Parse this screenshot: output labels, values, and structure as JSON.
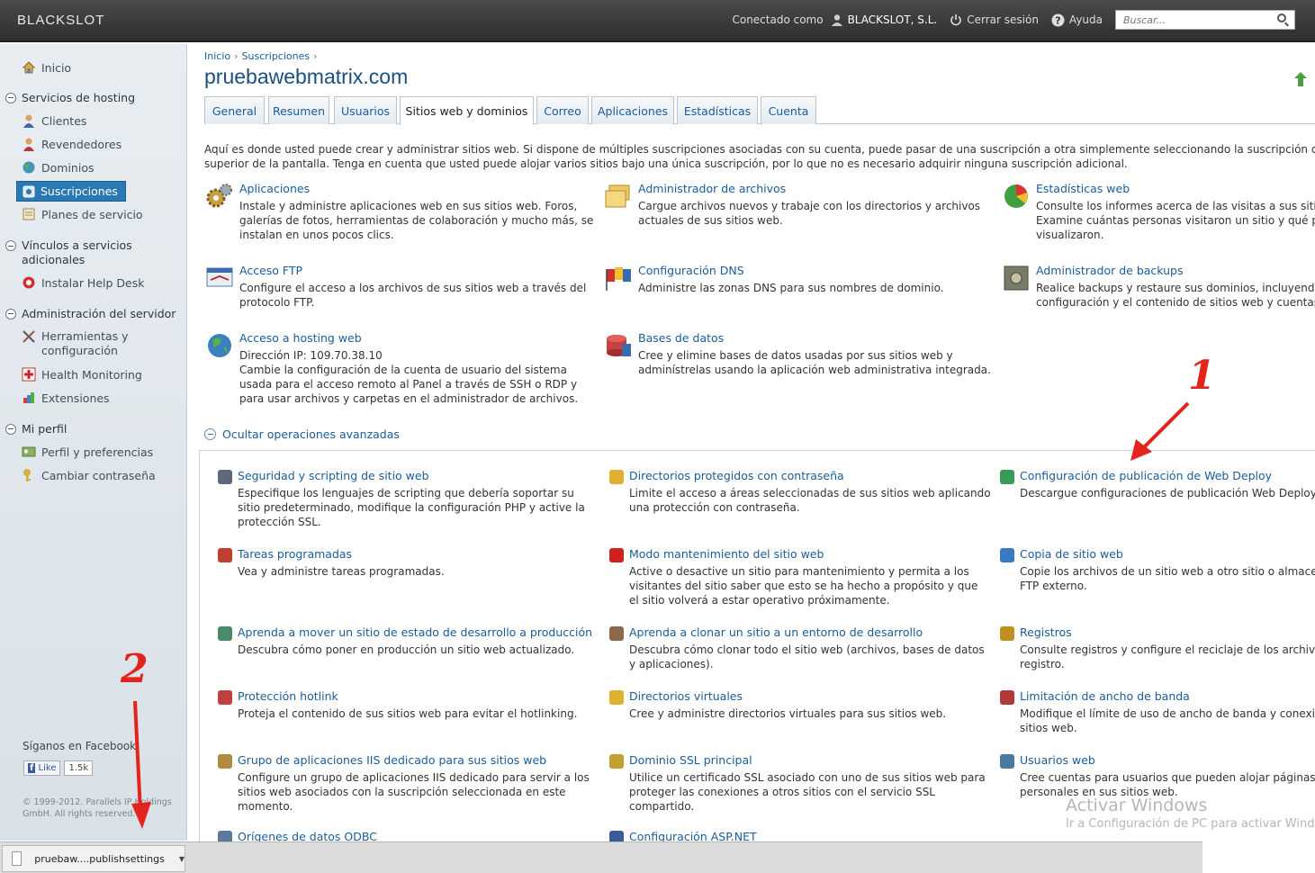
{
  "header": {
    "logo": "BLACKSLOT",
    "connected_as": "Conectado como",
    "user": "BLACKSLOT, S.L.",
    "logout": "Cerrar sesión",
    "help": "Ayuda",
    "search_placeholder": "Buscar..."
  },
  "sidebar": {
    "home": "Inicio",
    "sections": [
      {
        "title": "Servicios de hosting",
        "items": [
          "Clientes",
          "Revendedores",
          "Dominios",
          "Suscripciones",
          "Planes de servicio"
        ]
      },
      {
        "title": "Vínculos a servicios adicionales",
        "items": [
          "Instalar Help Desk"
        ]
      },
      {
        "title": "Administración del servidor",
        "items": [
          "Herramientas y configuración",
          "Health Monitoring",
          "Extensiones"
        ]
      },
      {
        "title": "Mi perfil",
        "items": [
          "Perfil y preferencias",
          "Cambiar contraseña"
        ]
      }
    ],
    "active_item": "Suscripciones",
    "facebook_label": "Síganos en Facebook",
    "facebook_like": "Like",
    "facebook_count": "1.5k",
    "copyright": "© 1999-2012. Parallels IP Holdings GmbH. All rights reserved."
  },
  "breadcrumb": [
    "Inicio",
    "Suscripciones"
  ],
  "page_title": "pruebawebmatrix.com",
  "tabs": [
    "General",
    "Resumen",
    "Usuarios",
    "Sitios web y dominios",
    "Correo",
    "Aplicaciones",
    "Estadísticas",
    "Cuenta"
  ],
  "active_tab": "Sitios web y dominios",
  "intro": [
    "Aquí es donde usted puede crear y administrar sitios web. Si dispone de múltiples suscripciones asociadas con su cuenta, puede pasar de una suscripción a otra simplemente seleccionando la suscripción deseada",
    "superior de la pantalla. Tenga en cuenta que usted puede alojar varios sitios bajo una única suscripción, por lo que no es necesario adquirir ninguna suscripción adicional."
  ],
  "tools": [
    {
      "title": "Aplicaciones",
      "desc": "Instale y administre aplicaciones web en sus sitios web. Foros,\ngalerías de fotos, herramientas de colaboración y mucho más, se\ninstalan en unos pocos clics.",
      "icon": "gears-icon"
    },
    {
      "title": "Administrador de archivos",
      "desc": "Cargue archivos nuevos y trabaje con los directorios y archivos\nactuales de sus sitios web.",
      "icon": "folders-icon"
    },
    {
      "title": "Estadísticas web",
      "desc": "Consulte los informes acerca de las visitas a sus sitio\nExamine cuántas personas visitaron un sitio y qué pá\nvisualizaron.",
      "icon": "pie-chart-icon"
    },
    {
      "title": "Acceso FTP",
      "desc": "Configure el acceso a los archivos de sus sitios web a través del\nprotocolo FTP.",
      "icon": "ftp-icon"
    },
    {
      "title": "Configuración DNS",
      "desc": "Administre las zonas DNS para sus nombres de dominio.",
      "icon": "dns-flags-icon"
    },
    {
      "title": "Administrador de backups",
      "desc": "Realice backups y restaure sus dominios, incluyendo\nconfiguración y el contenido de sitios web y cuentas",
      "icon": "safe-icon"
    },
    {
      "title": "Acceso a hosting web",
      "desc": "Dirección IP: 109.70.38.10\nCambie la configuración de la cuenta de usuario del sistema\nusada para el acceso remoto al Panel a través de SSH o RDP y\npara usar archivos y carpetas en el administrador de archivos.",
      "icon": "globe-icon"
    },
    {
      "title": "Bases de datos",
      "desc": "Cree y elimine bases de datos usadas por sus sitios web y\nadminístrelas usando la aplicación web administrativa integrada.",
      "icon": "database-icon"
    }
  ],
  "advanced_toggle": "Ocultar operaciones avanzadas",
  "advanced": [
    {
      "title": "Seguridad y scripting de sitio web",
      "desc": "Especifique los lenguajes de scripting que debería soportar su\nsitio predeterminado, modifique la configuración PHP y active la\nprotección SSL.",
      "icon": "sliders-icon",
      "color": "#5a6a7a"
    },
    {
      "title": "Directorios protegidos con contraseña",
      "desc": "Limite el acceso a áreas seleccionadas de sus sitios web aplicando\nuna protección con contraseña.",
      "icon": "locked-folder-icon",
      "color": "#e0b030"
    },
    {
      "title": "Configuración de publicación de Web Deploy",
      "desc": "Descargue configuraciones de publicación Web Deploy.",
      "icon": "web-deploy-icon",
      "color": "#3a9a5a"
    },
    {
      "title": "Tareas programadas",
      "desc": "Vea y administre tareas programadas.",
      "icon": "calendar-icon",
      "color": "#c04030"
    },
    {
      "title": "Modo mantenimiento del sitio web",
      "desc": "Active o desactive un sitio para mantenimiento y permita a los\nvisitantes del sitio saber que esto se ha hecho a propósito y que\nel sitio volverá a estar operativo próximamente.",
      "icon": "no-entry-icon",
      "color": "#d02020"
    },
    {
      "title": "Copia de sitio web",
      "desc": "Copie los archivos de un sitio web a otro sitio o almacen\nFTP externo.",
      "icon": "copy-icon",
      "color": "#3a7ac0"
    },
    {
      "title": "Aprenda a mover un sitio de estado de desarrollo a producción",
      "desc": "Descubra cómo poner en producción un sitio web actualizado.",
      "icon": "move-site-icon",
      "color": "#4a8a6a"
    },
    {
      "title": "Aprenda a clonar un sitio a un entorno de desarrollo",
      "desc": "Descubra cómo clonar todo el sitio web (archivos, bases de datos\ny aplicaciones).",
      "icon": "clone-house-icon",
      "color": "#8a6a4a"
    },
    {
      "title": "Registros",
      "desc": "Consulte registros y configure el reciclaje de los archivo\nregistro.",
      "icon": "log-icon",
      "color": "#c09020"
    },
    {
      "title": "Protección hotlink",
      "desc": "Proteja el contenido de sus sitios web para evitar el hotlinking.",
      "icon": "shield-icon",
      "color": "#c04040"
    },
    {
      "title": "Directorios virtuales",
      "desc": "Cree y administre directorios virtuales para sus sitios web.",
      "icon": "folder-icon",
      "color": "#e0b030"
    },
    {
      "title": "Limitación de ancho de banda",
      "desc": "Modifique el límite de uso de ancho de banda y conexion\nsitios web.",
      "icon": "bandwidth-icon",
      "color": "#b03a3a"
    },
    {
      "title": "Grupo de aplicaciones IIS dedicado para sus sitios web",
      "desc": "Configure un grupo de aplicaciones IIS dedicado para servir a los\nsitios web asociados con la suscripción seleccionada en este\nmomento.",
      "icon": "app-pool-icon",
      "color": "#b08a40"
    },
    {
      "title": "Dominio SSL principal",
      "desc": "Utilice un certificado SSL asociado con uno de sus sitios web para\nproteger las conexiones a otros sitios con el servicio SSL\ncompartido.",
      "icon": "ssl-lock-icon",
      "color": "#c0a030"
    },
    {
      "title": "Usuarios web",
      "desc": "Cree cuentas para usuarios que pueden alojar páginas w\npersonales en sus sitios web.",
      "icon": "web-users-icon",
      "color": "#4a7aa0"
    },
    {
      "title": "Orígenes de datos ODBC",
      "desc": "",
      "icon": "odbc-icon",
      "color": "#5a7a9a"
    },
    {
      "title": "Configuración ASP.NET",
      "desc": "",
      "icon": "aspnet-icon",
      "color": "#3a5a9a"
    }
  ],
  "annotations": {
    "one": "1",
    "two": "2",
    "color": "#e3231d"
  },
  "download": {
    "filename": "pruebaw....publishsettings"
  },
  "watermark": {
    "line1": "Activar Windows",
    "line2": "Ir a Configuración de PC para activar Windows."
  }
}
